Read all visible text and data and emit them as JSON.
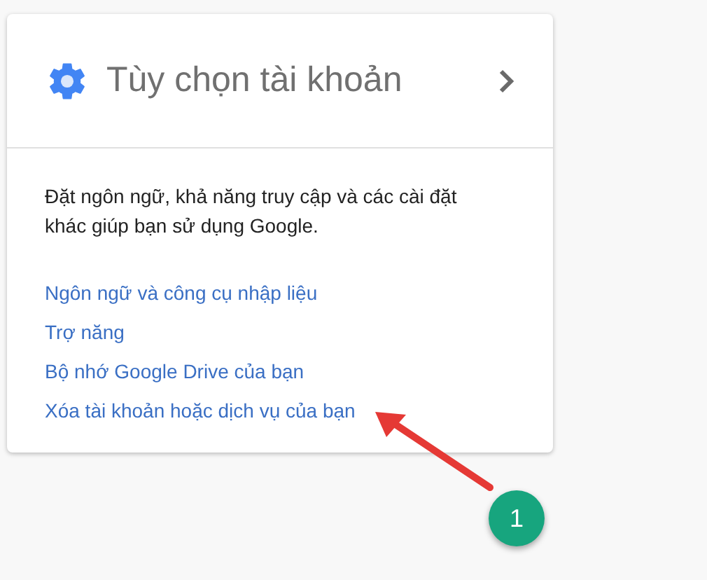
{
  "card": {
    "title": "Tùy chọn tài khoản",
    "description": "Đặt ngôn ngữ, khả năng truy cập và các cài đặt khác giúp bạn sử dụng Google.",
    "links": [
      "Ngôn ngữ và công cụ nhập liệu",
      "Trợ năng",
      "Bộ nhớ Google Drive của bạn",
      "Xóa tài khoản hoặc dịch vụ của bạn"
    ]
  },
  "annotation": {
    "label": "1"
  }
}
